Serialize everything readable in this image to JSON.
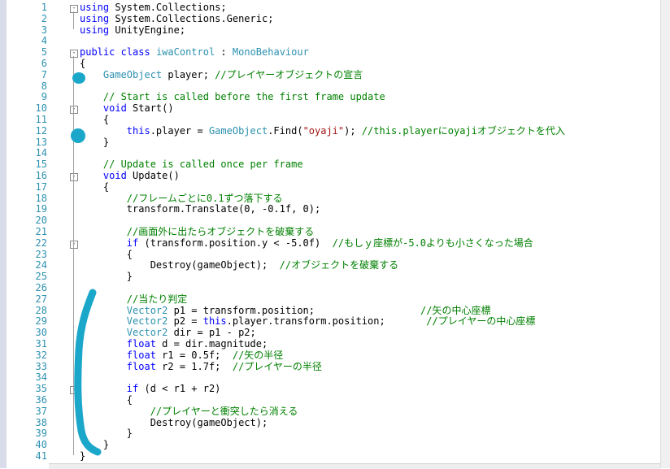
{
  "editor": {
    "lines": [
      {
        "n": "1",
        "fold": "-",
        "parts": [
          {
            "c": "kw",
            "t": "using"
          },
          {
            "t": " System.Collections;"
          }
        ]
      },
      {
        "n": "2",
        "parts": [
          {
            "c": "kw",
            "t": "using"
          },
          {
            "t": " System.Collections.Generic;"
          }
        ]
      },
      {
        "n": "3",
        "parts": [
          {
            "c": "kw",
            "t": "using"
          },
          {
            "t": " UnityEngine;"
          }
        ]
      },
      {
        "n": "4",
        "parts": []
      },
      {
        "n": "5",
        "fold": "-",
        "parts": [
          {
            "c": "kw",
            "t": "public"
          },
          {
            "t": " "
          },
          {
            "c": "kw",
            "t": "class"
          },
          {
            "t": " "
          },
          {
            "c": "ty",
            "t": "iwaControl"
          },
          {
            "t": " : "
          },
          {
            "c": "ty",
            "t": "MonoBehaviour"
          }
        ]
      },
      {
        "n": "6",
        "parts": [
          {
            "t": "{"
          }
        ]
      },
      {
        "n": "7",
        "parts": [
          {
            "t": "    "
          },
          {
            "c": "ty",
            "t": "GameObject"
          },
          {
            "t": " player; "
          },
          {
            "c": "cm",
            "t": "//プレイヤーオブジェクトの宣言"
          }
        ]
      },
      {
        "n": "8",
        "parts": []
      },
      {
        "n": "9",
        "parts": [
          {
            "t": "    "
          },
          {
            "c": "cm",
            "t": "// Start is called before the first frame update"
          }
        ]
      },
      {
        "n": "10",
        "fold": "-",
        "parts": [
          {
            "t": "    "
          },
          {
            "c": "kw",
            "t": "void"
          },
          {
            "t": " Start()"
          }
        ]
      },
      {
        "n": "11",
        "parts": [
          {
            "t": "    {"
          }
        ]
      },
      {
        "n": "12",
        "parts": [
          {
            "t": "        "
          },
          {
            "c": "kw",
            "t": "this"
          },
          {
            "t": ".player = "
          },
          {
            "c": "ty",
            "t": "GameObject"
          },
          {
            "t": ".Find("
          },
          {
            "c": "st",
            "t": "\"oyaji\""
          },
          {
            "t": "); "
          },
          {
            "c": "cm",
            "t": "//this.playerにoyajiオブジェクトを代入"
          }
        ]
      },
      {
        "n": "13",
        "parts": [
          {
            "t": "    }"
          }
        ]
      },
      {
        "n": "14",
        "parts": []
      },
      {
        "n": "15",
        "parts": [
          {
            "t": "    "
          },
          {
            "c": "cm",
            "t": "// Update is called once per frame"
          }
        ]
      },
      {
        "n": "16",
        "fold": "-",
        "parts": [
          {
            "t": "    "
          },
          {
            "c": "kw",
            "t": "void"
          },
          {
            "t": " Update()"
          }
        ]
      },
      {
        "n": "17",
        "parts": [
          {
            "t": "    {"
          }
        ]
      },
      {
        "n": "18",
        "parts": [
          {
            "t": "        "
          },
          {
            "c": "cm",
            "t": "//フレームごとに0.1ずつ落下する"
          }
        ]
      },
      {
        "n": "19",
        "parts": [
          {
            "t": "        transform.Translate(0, -0.1f, 0);"
          }
        ]
      },
      {
        "n": "20",
        "parts": []
      },
      {
        "n": "21",
        "parts": [
          {
            "t": "        "
          },
          {
            "c": "cm",
            "t": "//画面外に出たらオブジェクトを破棄する"
          }
        ]
      },
      {
        "n": "22",
        "fold": "-",
        "parts": [
          {
            "t": "        "
          },
          {
            "c": "kw",
            "t": "if"
          },
          {
            "t": " (transform.position.y < -5.0f)  "
          },
          {
            "c": "cm",
            "t": "//もしｙ座標が-5.0よりも小さくなった場合"
          }
        ]
      },
      {
        "n": "23",
        "parts": [
          {
            "t": "        {"
          }
        ]
      },
      {
        "n": "24",
        "parts": [
          {
            "t": "            Destroy(gameObject);  "
          },
          {
            "c": "cm",
            "t": "//オブジェクトを破棄する"
          }
        ]
      },
      {
        "n": "25",
        "parts": [
          {
            "t": "        }"
          }
        ]
      },
      {
        "n": "26",
        "parts": []
      },
      {
        "n": "27",
        "parts": [
          {
            "t": "        "
          },
          {
            "c": "cm",
            "t": "//当たり判定"
          }
        ]
      },
      {
        "n": "28",
        "parts": [
          {
            "t": "        "
          },
          {
            "c": "ty",
            "t": "Vector2"
          },
          {
            "t": " p1 = transform.position;                  "
          },
          {
            "c": "cm",
            "t": "//矢の中心座標"
          }
        ]
      },
      {
        "n": "29",
        "parts": [
          {
            "t": "        "
          },
          {
            "c": "ty",
            "t": "Vector2"
          },
          {
            "t": " p2 = "
          },
          {
            "c": "kw",
            "t": "this"
          },
          {
            "t": ".player.transform.position;       "
          },
          {
            "c": "cm",
            "t": "//プレイヤーの中心座標"
          }
        ]
      },
      {
        "n": "30",
        "parts": [
          {
            "t": "        "
          },
          {
            "c": "ty",
            "t": "Vector2"
          },
          {
            "t": " dir = p1 - p2;"
          }
        ]
      },
      {
        "n": "31",
        "parts": [
          {
            "t": "        "
          },
          {
            "c": "kw",
            "t": "float"
          },
          {
            "t": " d = dir.magnitude;"
          }
        ]
      },
      {
        "n": "32",
        "parts": [
          {
            "t": "        "
          },
          {
            "c": "kw",
            "t": "float"
          },
          {
            "t": " r1 = 0.5f;  "
          },
          {
            "c": "cm",
            "t": "//矢の半径"
          }
        ]
      },
      {
        "n": "33",
        "parts": [
          {
            "t": "        "
          },
          {
            "c": "kw",
            "t": "float"
          },
          {
            "t": " r2 = 1.7f;  "
          },
          {
            "c": "cm",
            "t": "//プレイヤーの半径"
          }
        ]
      },
      {
        "n": "34",
        "parts": []
      },
      {
        "n": "35",
        "fold": "-",
        "parts": [
          {
            "t": "        "
          },
          {
            "c": "kw",
            "t": "if"
          },
          {
            "t": " (d < r1 + r2)"
          }
        ]
      },
      {
        "n": "36",
        "parts": [
          {
            "t": "        {"
          }
        ]
      },
      {
        "n": "37",
        "parts": [
          {
            "t": "            "
          },
          {
            "c": "cm",
            "t": "//プレイヤーと衝突したら消える"
          }
        ]
      },
      {
        "n": "38",
        "parts": [
          {
            "t": "            Destroy(gameObject);"
          }
        ]
      },
      {
        "n": "39",
        "parts": [
          {
            "t": "        }"
          }
        ]
      },
      {
        "n": "40",
        "parts": [
          {
            "t": "    }"
          }
        ]
      },
      {
        "n": "41",
        "parts": [
          {
            "t": "}"
          }
        ]
      }
    ]
  },
  "colors": {
    "keyword": "#0000ff",
    "type": "#2b91af",
    "comment": "#008000",
    "string": "#a31515",
    "line_number": "#2b91af",
    "annotation": "#1aa7c9"
  }
}
